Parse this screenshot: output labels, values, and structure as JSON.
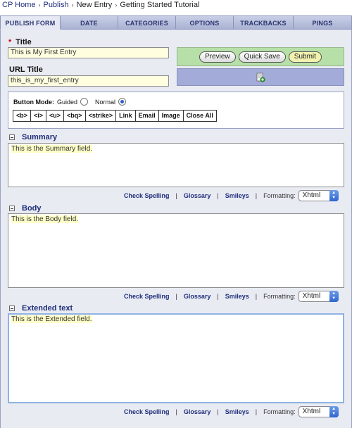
{
  "breadcrumb": [
    "CP Home",
    "Publish",
    "New Entry",
    "Getting Started Tutorial"
  ],
  "breadcrumb_separator": "›",
  "tabs": [
    "PUBLISH FORM",
    "DATE",
    "CATEGORIES",
    "OPTIONS",
    "TRACKBACKS",
    "PINGS"
  ],
  "active_tab": "PUBLISH FORM",
  "title": {
    "label": "Title",
    "required_mark": "*",
    "value": "This is My First Entry"
  },
  "url_title": {
    "label": "URL Title",
    "value": "this_is_my_first_entry"
  },
  "actions": {
    "preview": "Preview",
    "quick_save": "Quick Save",
    "submit": "Submit",
    "upload_icon": "file-upload-icon"
  },
  "button_mode": {
    "label": "Button Mode:",
    "guided": "Guided",
    "normal": "Normal",
    "selected": "Normal"
  },
  "format_buttons": [
    "<b>",
    "<i>",
    "<u>",
    "<bq>",
    "<strike>",
    "Link",
    "Email",
    "Image",
    "Close All"
  ],
  "tools": {
    "check_spelling": "Check Spelling",
    "glossary": "Glossary",
    "smileys": "Smileys",
    "formatting_label": "Formatting:",
    "formatting_value": "Xhtml",
    "pipe": "|"
  },
  "sections": {
    "summary": {
      "label": "Summary",
      "text": "This is the Summary field."
    },
    "body": {
      "label": "Body",
      "text": "This is the Body field."
    },
    "extended": {
      "label": "Extended text",
      "text": "This is the Extended field."
    }
  },
  "colors": {
    "tab_bar": "#a9b2d3",
    "panel": "#e9ebf3",
    "submit_box": "#b6e0a7",
    "upload_box": "#a3acd8",
    "input_bg": "#ffffe0",
    "section_title": "#1f2f7a"
  }
}
